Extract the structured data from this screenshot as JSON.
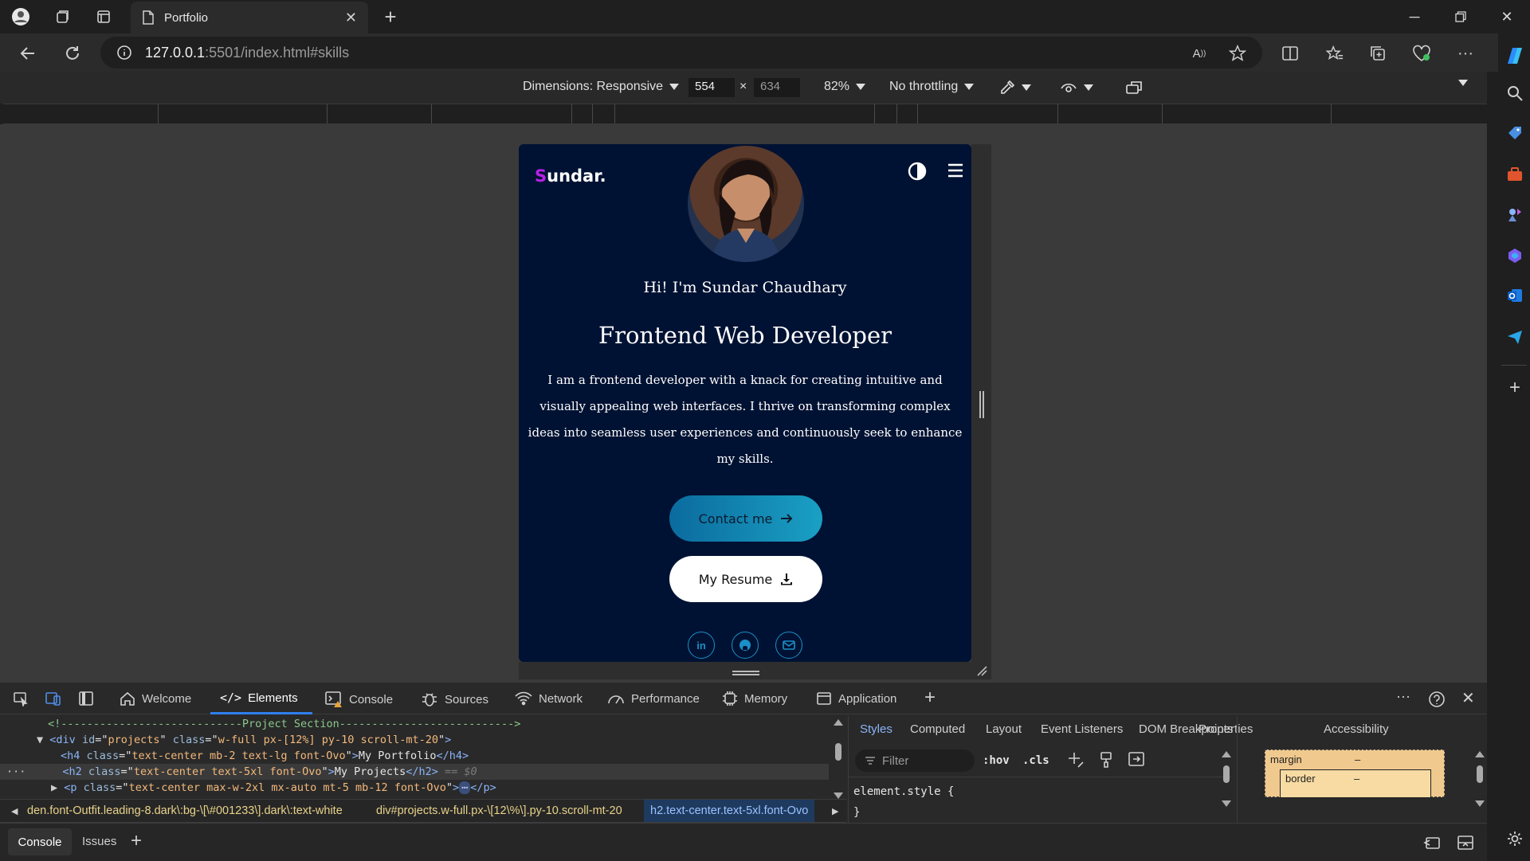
{
  "browser": {
    "tab_title": "Portfolio",
    "url_host": "127.0.0.1",
    "url_path": ":5501/index.html#skills"
  },
  "device_toolbar": {
    "dimensions_label": "Dimensions: Responsive",
    "width": "554",
    "times": "×",
    "height": "634",
    "zoom": "82%",
    "throttling": "No throttling"
  },
  "site": {
    "logo_initial": "S",
    "logo_rest": "undar",
    "logo_dot": ".",
    "greeting": "Hi! I'm Sundar Chaudhary",
    "headline": "Frontend Web Developer",
    "bio_lines": [
      "I am a frontend developer with a knack for creating intuitive and",
      "visually appealing web interfaces. I thrive on transforming complex",
      "ideas into seamless user experiences and continuously seek to enhance",
      "my skills."
    ],
    "contact_button": "Contact me",
    "resume_button": "My Resume",
    "social": [
      "in",
      "gh",
      "mail"
    ]
  },
  "devtools": {
    "tabs": [
      "Welcome",
      "Elements",
      "Console",
      "Sources",
      "Network",
      "Performance",
      "Memory",
      "Application"
    ],
    "code_lines": {
      "l1": "<!----------------------------Project Section--------------------------->",
      "l2_tag": "div",
      "l2_id": "projects",
      "l2_class": "w-full px-[12%] py-10 scroll-mt-20",
      "l3_class": "text-center mb-2 text-lg font-Ovo",
      "l3_text": "My Portfolio",
      "l4_class": "text-center text-5xl font-Ovo",
      "l4_text": "My Projects",
      "l4_suffix": "== $0",
      "l5_class": "text-center max-w-2xl mx-auto mt-5 mb-12 font-Ovo"
    },
    "breadcrumbs": [
      "den.font-Outfit.leading-8.dark\\:bg-\\[\\#001233\\].dark\\:text-white",
      "div#projects.w-full.px-\\[12\\%\\].py-10.scroll-mt-20",
      "h2.text-center.text-5xl.font-Ovo"
    ],
    "style_tabs": [
      "Styles",
      "Computed",
      "Layout",
      "Event Listeners",
      "DOM Breakpoints",
      "Properties",
      "Accessibility"
    ],
    "filter_placeholder": "Filter",
    "hov": ":hov",
    "cls": ".cls",
    "element_style_open": "element.style {",
    "element_style_close": "}",
    "box_margin": "margin",
    "box_border": "border",
    "box_dash": "–",
    "drawer_tabs": [
      "Console",
      "Issues"
    ]
  },
  "colors": {
    "site_bg": "#001233",
    "accent_purple": "#b820e6",
    "contact_gradient_start": "#0b6b9e",
    "contact_gradient_end": "#1aa0c4",
    "devtools_accent": "#2f80ed"
  }
}
